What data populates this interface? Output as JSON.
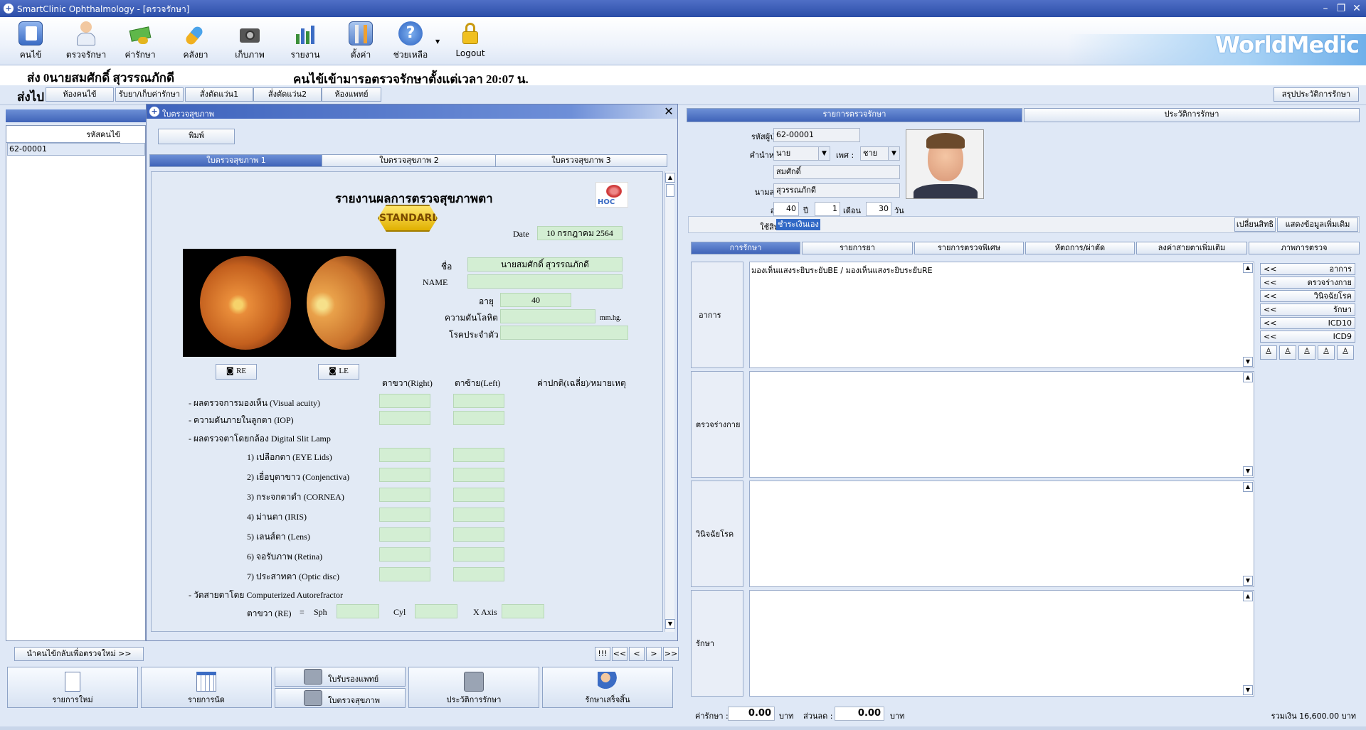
{
  "window": {
    "title": "SmartClinic Ophthalmology - [ตรวจรักษา]"
  },
  "toolbar": {
    "items": [
      {
        "label": "คนไข้",
        "icon": "patient-book-icon"
      },
      {
        "label": "ตรวจรักษา",
        "icon": "doctor-icon"
      },
      {
        "label": "ค่ารักษา",
        "icon": "money-icon"
      },
      {
        "label": "คลังยา",
        "icon": "medicine-icon"
      },
      {
        "label": "เก็บภาพ",
        "icon": "camera-icon"
      },
      {
        "label": "รายงาน",
        "icon": "report-chart-icon"
      },
      {
        "label": "ตั้งค่า",
        "icon": "settings-tools-icon"
      },
      {
        "label": "ช่วยเหลือ",
        "icon": "help-icon"
      },
      {
        "label": "Logout",
        "icon": "lock-icon"
      }
    ],
    "brand": "WorldMedic"
  },
  "header": {
    "patient": "ส่ง  0นายสมศักดิ์ สุวรรณภักดี",
    "arrival": "คนไข้เข้ามารอตรวจรักษาตั้งแต่เวลา 20:07 น."
  },
  "nav": {
    "label": "ส่งไป",
    "buttons": [
      "ห้องคนไข้",
      "รับยา/เก็บค่ารักษา",
      "สั่งตัดแว่น1",
      "สั่งตัดแว่น2",
      "ห้องแพทย์"
    ],
    "summary": "สรุปประวัติการรักษา"
  },
  "left": {
    "header": "รหัสคนไข้",
    "rows": [
      "62-00001"
    ],
    "back_button": "นำคนไข้กลับเพื่อตรวจใหม่ >>"
  },
  "dialog": {
    "title": "ใบตรวจสุขภาพ",
    "print": "พิมพ์",
    "tabs": [
      "ใบตรวจสุขภาพ 1",
      "ใบตรวจสุขภาพ 2",
      "ใบตรวจสุขภาพ 3"
    ],
    "report_title": "รายงานผลการตรวจสุขภาพตา",
    "badge": "STANDARD",
    "logo": "HOC",
    "date_label": "Date",
    "date_value": "10 กรกฎาคม 2564",
    "name_label": "ชื่อ",
    "name_value": "นายสมศักดิ์ สุวรรณภักดี",
    "name_en_label": "NAME",
    "name_en_value": "",
    "age_label": "อายุ",
    "age_value": "40",
    "bp_label": "ความดันโลหิต",
    "bp_value": "",
    "bp_unit": "mm.hg.",
    "disease_label": "โรคประจำตัว",
    "disease_value": "",
    "re_btn": "RE",
    "le_btn": "LE",
    "col_right": "ตาขวา(Right)",
    "col_left": "ตาซ้าย(Left)",
    "col_note": "ค่าปกติ(เฉลี่ย)/หมายเหตุ",
    "rows": [
      "- ผลตรวจการมองเห็น (Visual acuity)",
      "- ความดันภายในลูกตา (IOP)",
      "- ผลตรวจตาโดยกล้อง Digital Slit Lamp",
      "1) เปลือกตา (EYE Lids)",
      "2) เยื่อบุตาขาว (Conjenctiva)",
      "3) กระจกตาดำ (CORNEA)",
      "4) ม่านตา (IRIS)",
      "5) เลนส์ตา (Lens)",
      "6) จอรับภาพ (Retina)",
      "7) ประสาทตา (Optic disc)",
      "- วัดสายตาโดย Computerized Autorefractor"
    ],
    "re_row_label": "ตาขวา (RE)",
    "eq": "=",
    "sph": "Sph",
    "cyl": "Cyl",
    "xaxis": "X Axis"
  },
  "pager": [
    "!!!",
    "<<",
    "<",
    ">",
    ">>"
  ],
  "bottom_buttons": [
    {
      "label": "รายการใหม่",
      "icon": "document-icon"
    },
    {
      "label": "รายการนัด",
      "icon": "calendar-icon"
    },
    {
      "label": "ใบรับรองแพทย์",
      "icon": "printer-icon"
    },
    {
      "label": "ใบตรวจสุขภาพ",
      "icon": "printer-icon"
    },
    {
      "label": "ประวัติการรักษา",
      "icon": "printer-check-icon"
    },
    {
      "label": "รักษาเสร็จสิ้น",
      "icon": "users-check-icon"
    }
  ],
  "right": {
    "tabs": [
      "รายการตรวจรักษา",
      "ประวัติการรักษา"
    ],
    "hn_label": "รหัสผู้ป่วย :",
    "hn_value": "62-00001",
    "prefix_label": "คำนำหน้า :",
    "prefix_value": "นาย",
    "sex_label": "เพศ :",
    "sex_value": "ชาย",
    "fname_label": "ชื่อ :",
    "fname_value": "สมศักดิ์",
    "lname_label": "นามสกุล :",
    "lname_value": "สุวรรณภักดี",
    "age_label": "อายุ :",
    "age_y": "40",
    "age_y_unit": "ปี",
    "age_m": "1",
    "age_m_unit": "เดือน",
    "age_d": "30",
    "age_d_unit": "วัน",
    "right_label": "ใช้สิทธิ :",
    "right_value": "ชำระเงินเอง",
    "change_right": "เปลี่ยนสิทธิ",
    "more_info": "แสดงข้อมูลเพิ่มเติม",
    "subtabs": [
      "การรักษา",
      "รายการยา",
      "รายการตรวจพิเศษ",
      "หัตถการ/ผ่าตัด",
      "ลงค่าสายตาเพิ่มเติม",
      "ภาพการตรวจ"
    ],
    "sections": [
      {
        "label": "อาการ",
        "text": "มองเห็นแสงระยิบระยับBE / มองเห็นแสงระยิบระยับRE"
      },
      {
        "label": "ตรวจร่างกาย",
        "text": ""
      },
      {
        "label": "วินิจฉัยโรค",
        "text": ""
      },
      {
        "label": "รักษา",
        "text": ""
      }
    ],
    "side_buttons": [
      "อาการ",
      "ตรวจร่างกาย",
      "วินิจฉัยโรค",
      "รักษา",
      "ICD10",
      "ICD9"
    ],
    "side_prefix": "<<",
    "fee_label": "ค่ารักษา :",
    "fee_value": "0.00",
    "baht": "บาท",
    "discount_label": "ส่วนลด :",
    "discount_value": "0.00",
    "total": "รวมเงิน 16,600.00 บาท"
  }
}
